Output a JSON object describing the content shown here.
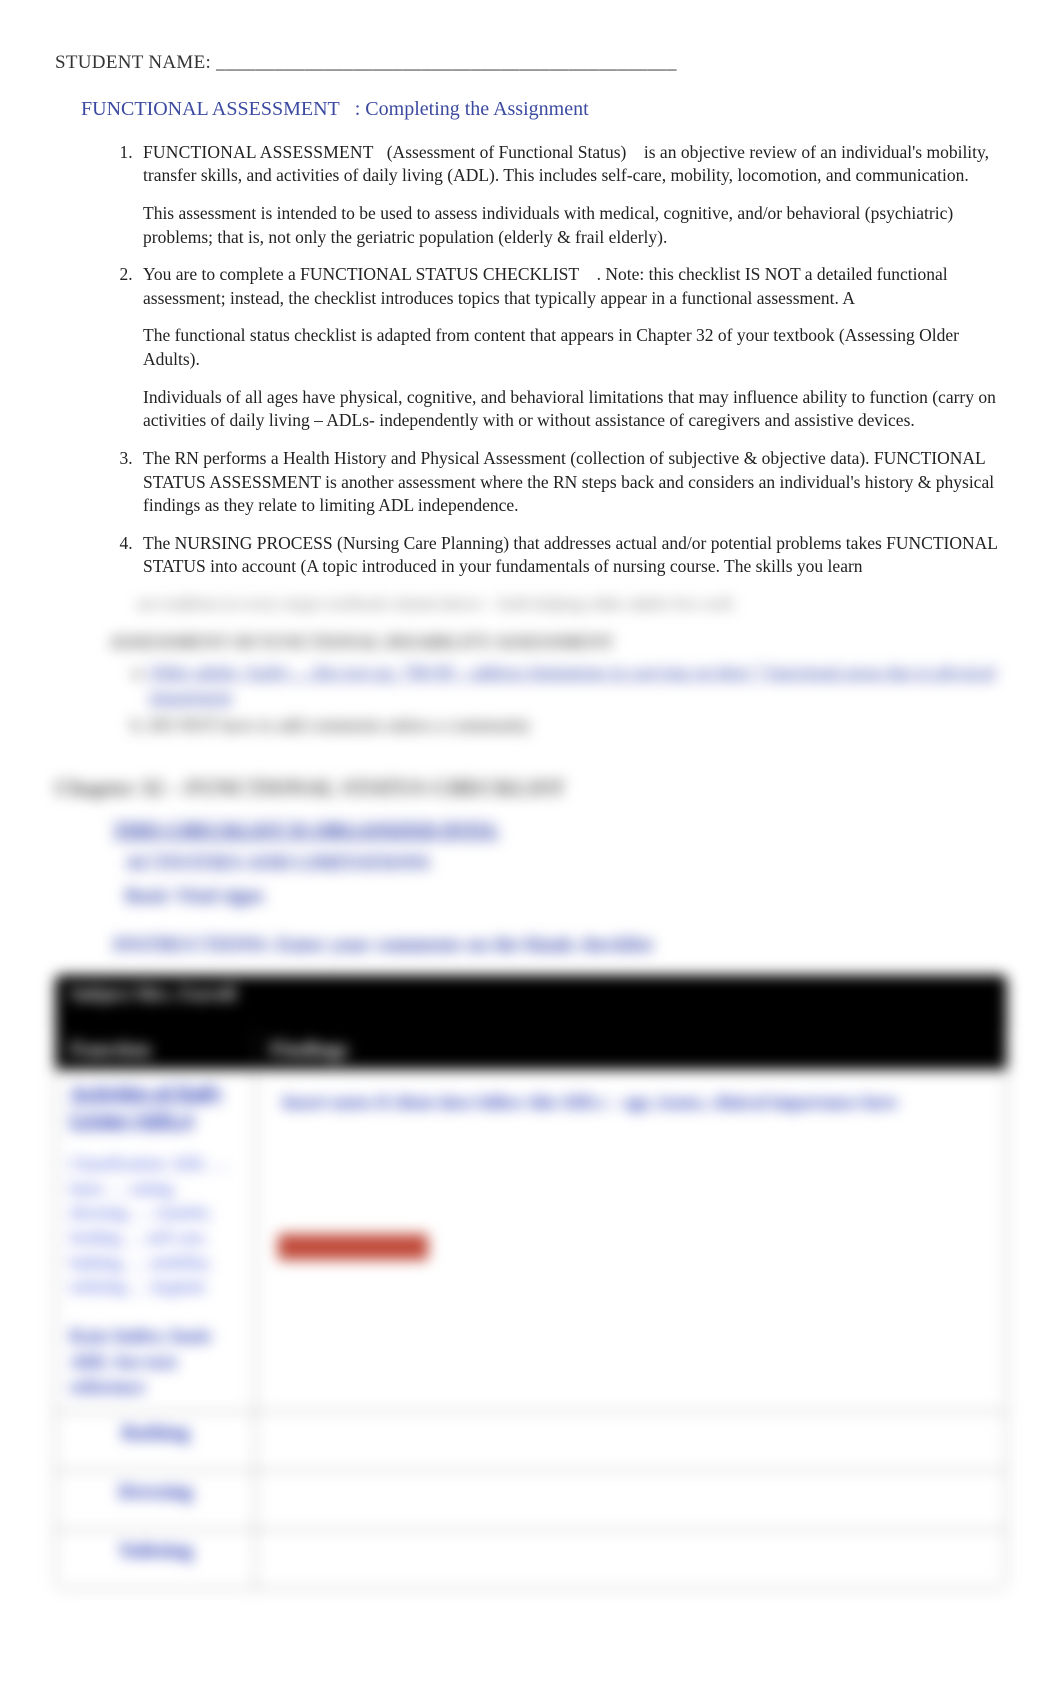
{
  "header": {
    "student_name_label": "STUDENT NAME:",
    "student_name_line": "_______________________________________________"
  },
  "title": {
    "main": "FUNCTIONAL ASSESSMENT",
    "suffix": ": Completing the Assignment"
  },
  "items": {
    "i1a": "FUNCTIONAL ASSESSMENT",
    "i1b": "(Assessment of Functional Status)",
    "i1c": "is an objective review of an individual's mobility, transfer skills, and activities of daily living (ADL). This includes self-care, mobility, locomotion, and communication.",
    "i1d": "This assessment is intended to be used to assess individuals with medical, cognitive, and/or behavioral (psychiatric) problems; that is, not only the geriatric population (elderly & frail elderly).",
    "i2a": "You are to complete a FUNCTIONAL STATUS CHECKLIST",
    "i2b": ".  Note: this checklist IS NOT a detailed functional assessment; instead, the checklist introduces topics that typically appear in a functional assessment. A",
    "i2c": "The functional status checklist is adapted from content that appears in Chapter 32 of your textbook (Assessing Older Adults).",
    "i2d": "Individuals of all ages have physical, cognitive, and behavioral limitations that may influence ability to function (carry on activities of daily living – ADLs- independently with or without assistance of caregivers and assistive devices.",
    "i3": "The RN performs a Health History and Physical Assessment (collection of subjective & objective data). FUNCTIONAL STATUS ASSESSMENT is another assessment where the RN steps back and considers an individual's history & physical findings as they relate to limiting ADL independence.",
    "i4": "The NURSING PROCESS (Nursing Care Planning) that addresses actual and/or potential problems takes FUNCTIONAL STATUS into account (A topic introduced in your fundamentals of nursing course. The skills you learn"
  },
  "blur": {
    "tail4": "are tradition in every major textbook related above – both helping older adults live well.",
    "i5": "ASSESSMENT OF FUNCTIONAL DISABILITY ASSESSMENT",
    "i5a": "Older adults, frailty ... this text pg. 798-99 – address limitations in carrying on their 7 functional areas due to physical impairment",
    "i5b": "DO NOT have to add comments unless a community",
    "chapter": "Chapter 32 – FUNCTIONAL STATUS CHECKLIST",
    "bullet1": "THIS CHECKLIST IS ORGANIZED INTO:",
    "bullet1a": "ACTIVITIES AND LIMITATIONS",
    "bullet1b": "Basic Vital signs",
    "bullet2": "INSTRUCTIONS: Enter your comments on the blank checklist",
    "client_row": "Subject Mrs. Farrell",
    "func_hdr": "Function",
    "find_hdr": "Findings",
    "adl_head": "Activities of Daily Living (ADLs)",
    "adl_body": "Classification: ADL\n… basic\n… eating, dressing,\n… transfer, feeding\n… self care, bathing,\n… mobility, toileting\n… hygiene",
    "katz": "Katz Index;\nbasic ADL\nSee text reference",
    "find_top": "Insert notes if client does follow this ADLs – age, issues, clinical importance here",
    "row1": "Bathing",
    "row2": "Dressing",
    "row3": "Toileting"
  }
}
